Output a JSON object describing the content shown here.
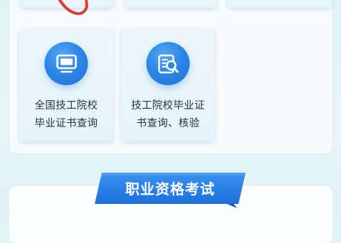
{
  "cards": [
    {
      "line1": "全国技工院校",
      "line2": "毕业证书查询",
      "icon": "monitor-icon"
    },
    {
      "line1": "技工院校毕业证",
      "line2": "书查询、核验",
      "icon": "certificate-search-icon"
    }
  ],
  "section": {
    "title": "职业资格考试"
  },
  "colors": {
    "icon_blue": "#2e86e6",
    "ribbon_blue": "#2a7fe5",
    "hand_red": "#e23b35",
    "card_bg": "#eaf5fb"
  }
}
